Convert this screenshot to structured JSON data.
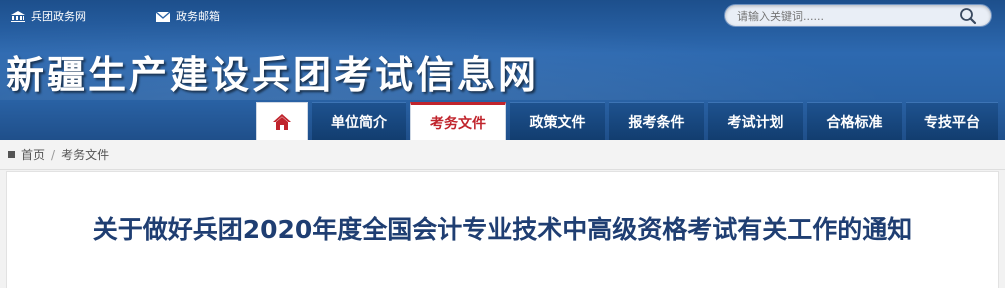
{
  "top_links": {
    "gov": "兵团政务网",
    "mail": "政务邮箱"
  },
  "search": {
    "placeholder": "请输入关键词......"
  },
  "site": {
    "title": "新疆生产建设兵团考试信息网"
  },
  "nav": {
    "items": [
      {
        "label": "单位简介"
      },
      {
        "label": "考务文件"
      },
      {
        "label": "政策文件"
      },
      {
        "label": "报考条件"
      },
      {
        "label": "考试计划"
      },
      {
        "label": "合格标准"
      },
      {
        "label": "专技平台"
      }
    ]
  },
  "breadcrumb": {
    "home": "首页",
    "separator": "/",
    "current": "考务文件"
  },
  "article": {
    "title": "关于做好兵团2020年度全国会计专业技术中高级资格考试有关工作的通知"
  },
  "colors": {
    "header_blue": "#2a63a6",
    "nav_blue": "#123d6f",
    "active_red": "#c0242c",
    "title_navy": "#1f3e72"
  }
}
